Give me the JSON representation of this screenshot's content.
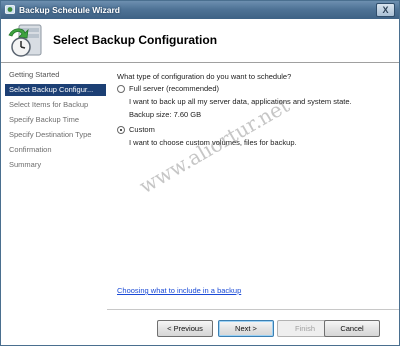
{
  "window": {
    "title": "Backup Schedule Wizard",
    "close_glyph": "X"
  },
  "header": {
    "title": "Select Backup Configuration",
    "icon": "backup-clock-icon"
  },
  "nav": {
    "items": [
      {
        "label": "Getting Started",
        "state": "visited"
      },
      {
        "label": "Select Backup Configur...",
        "state": "active"
      },
      {
        "label": "Select Items for Backup",
        "state": "pending"
      },
      {
        "label": "Specify Backup Time",
        "state": "pending"
      },
      {
        "label": "Specify Destination Type",
        "state": "pending"
      },
      {
        "label": "Confirmation",
        "state": "pending"
      },
      {
        "label": "Summary",
        "state": "pending"
      }
    ]
  },
  "content": {
    "question": "What type of configuration do you want to schedule?",
    "options": [
      {
        "label": "Full server (recommended)",
        "checked": false,
        "description": "I want to back up all my server data, applications and system state.",
        "detail": "Backup size: 7.60 GB"
      },
      {
        "label": "Custom",
        "checked": true,
        "description": "I want to choose custom volumes, files for backup."
      }
    ],
    "help_link": "Choosing what to include in a backup"
  },
  "footer": {
    "previous": "< Previous",
    "next": "Next >",
    "finish": "Finish",
    "cancel": "Cancel"
  },
  "watermark": "www.aliortur.net",
  "colors": {
    "titlebar": "#4f7396",
    "nav_active": "#1c3f74",
    "link": "#1a4ad6"
  }
}
